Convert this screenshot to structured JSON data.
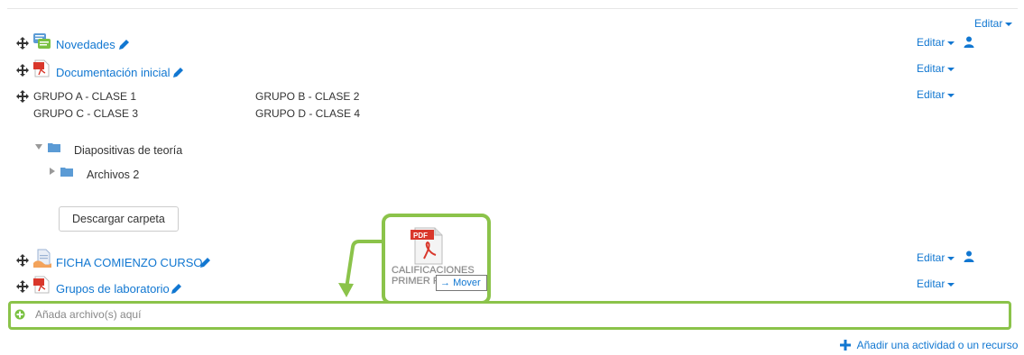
{
  "edit_label": "Editar",
  "items": [
    {
      "title": "Novedades",
      "icon": "forum-icon"
    },
    {
      "title": "Documentación inicial",
      "icon": "pdf-icon"
    }
  ],
  "groups": {
    "row1_col1": "GRUPO A - CLASE 1",
    "row1_col2": "GRUPO B - CLASE 2",
    "row2_col1": "GRUPO C - CLASE 3",
    "row2_col2": "GRUPO D - CLASE 4"
  },
  "folder": {
    "root": "Diapositivas de teoría",
    "child": "Archivos 2",
    "download_button": "Descargar carpeta"
  },
  "items_bottom": [
    {
      "title": "FICHA COMIENZO CURSO",
      "icon": "document-icon"
    },
    {
      "title": "Grupos de laboratorio",
      "icon": "pdf-icon"
    }
  ],
  "drag": {
    "pdf_badge": "PDF",
    "file_line1": "CALIFICACIONES",
    "file_line2": "PRIMER P...",
    "mover_tooltip": "Mover"
  },
  "dropzone_label": "Añada archivo(s) aquí",
  "add_activity": "Añadir una actividad o un recurso",
  "colors": {
    "link": "#1177d1",
    "highlight": "#8bc34a",
    "pdf": "#d9372b"
  }
}
